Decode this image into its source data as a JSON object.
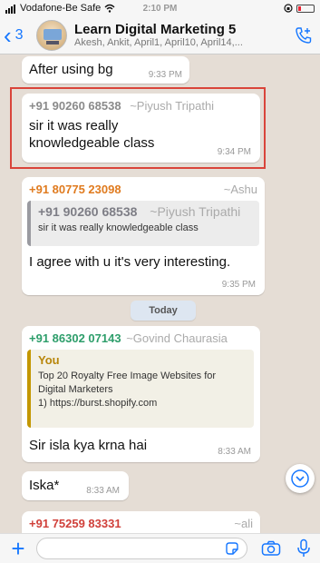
{
  "status": {
    "carrier": "Vodafone-Be Safe",
    "time": "2:10 PM"
  },
  "header": {
    "back_count": "3",
    "group_name": "Learn Digital Marketing 5",
    "members": "Akesh, Ankit, April1, April10, April14,..."
  },
  "messages": {
    "m1": {
      "text": "After using bg",
      "time": "9:33 PM"
    },
    "m2": {
      "number": "+91 90260 68538",
      "alias": "~Piyush Tripathi",
      "text": "sir it was really knowledgeable class",
      "time": "9:34 PM"
    },
    "m3": {
      "number": "+91 80775 23098",
      "alias": "~Ashu",
      "quote_number": "+91 90260 68538",
      "quote_alias": "~Piyush Tripathi",
      "quote_text": "sir it was really knowledgeable class",
      "text": "I agree with u it's very interesting.",
      "time": "9:35 PM"
    },
    "today": "Today",
    "m4": {
      "number": "+91 86302 07143",
      "alias": "~Govind Chaurasia",
      "quote_sender": "You",
      "quote_line1": "Top 20 Royalty Free Image Websites for",
      "quote_line2": "Digital Marketers",
      "quote_line3": "1) https://burst.shopify.com",
      "text": "Sir isla kya krna hai",
      "time": "8:33 AM"
    },
    "m5": {
      "text": "Iska*",
      "time": "8:33 AM"
    },
    "m6": {
      "number": "+91 75259 83331",
      "alias": "~ali"
    }
  },
  "colors": {
    "accent": "#1677ff",
    "sender_green": "#2e9e6b",
    "sender_orange": "#e07b1f",
    "sender_red": "#d0403a",
    "highlight": "#d9443a"
  }
}
